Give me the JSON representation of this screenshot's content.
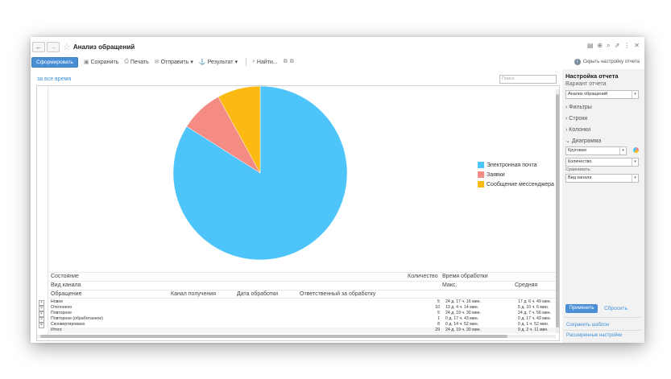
{
  "window": {
    "title": "Анализ обращений",
    "nav_back": "←",
    "nav_forward": "→",
    "star": "☆",
    "icons": [
      "report-icon",
      "print-icon",
      "search-icon",
      "link-icon",
      "more-icon",
      "close-icon"
    ],
    "icon_glyphs": [
      "▤",
      "⊕",
      "⌕",
      "⇗",
      "⋮",
      "✕"
    ]
  },
  "toolbar": {
    "generate_label": "Сформировать",
    "save_label": "Сохранить",
    "print_label": "Печать",
    "send_label": "Отправить",
    "result_label": "Результат",
    "find_label": "Найти...",
    "hide_settings_label": "Скрыть настройку отчета"
  },
  "period": "за все время",
  "search": {
    "placeholder": "Поиск"
  },
  "chart_data": {
    "type": "pie",
    "series": [
      {
        "name": "Электронная почта",
        "value": 84,
        "color": "#4dc5fa"
      },
      {
        "name": "Заявки",
        "value": 8,
        "color": "#f48c84"
      },
      {
        "name": "Сообщение мессенджера",
        "value": 8,
        "color": "#fbb912"
      }
    ],
    "legend_position": "right"
  },
  "table": {
    "headers": {
      "state": "Состояние",
      "channel": "Вид канала",
      "request": "Обращение",
      "receive_channel": "Канал получения",
      "process_date": "Дата обработки",
      "responsible": "Ответственный за обработку",
      "count": "Количество",
      "proc_time": "Время обработки",
      "max": "Макс.",
      "avg": "Средняя"
    },
    "rows": [
      {
        "name": "Новое",
        "count": "5",
        "max": "24 д. 17 ч. 16 мин.",
        "avg": "17 д. 6 ч. 49 мин."
      },
      {
        "name": "Отклонено",
        "count": "10",
        "max": "13 д. 4 ч. 14 мин.",
        "avg": "5 д. 10 ч. 6 мин."
      },
      {
        "name": "Повторное",
        "count": "5",
        "max": "24 д. 19 ч. 30 мин.",
        "avg": "24 д. 7 ч. 56 мин."
      },
      {
        "name": "Повторное (обработанное)",
        "count": "1",
        "max": "0 д. 17 ч. 43 мин.",
        "avg": "0 д. 17 ч. 43 мин."
      },
      {
        "name": "Сконвертировано",
        "count": "8",
        "max": "0 д. 14 ч. 52 мин.",
        "avg": "0 д. 1 ч. 52 мин."
      },
      {
        "name": "Итого",
        "count": "29",
        "max": "24 д. 19 ч. 30 мин.",
        "avg": "9 д. 2 ч. 11 мин."
      }
    ]
  },
  "panel": {
    "title": "Настройка отчета",
    "variant_label": "Вариант отчета",
    "variant_value": "Анализ обращений",
    "filters": "Фильтры",
    "rows": "Строки",
    "columns": "Колонки",
    "chart": "Диаграмма",
    "chart_type": "Круговая",
    "chart_measure": "Количество",
    "compare_label": "Сравнивать:",
    "compare_value": "Вид канала",
    "apply": "Применить",
    "reset": "Сбросить",
    "save_template": "Сохранить шаблон",
    "advanced": "Расширенные настройки"
  }
}
